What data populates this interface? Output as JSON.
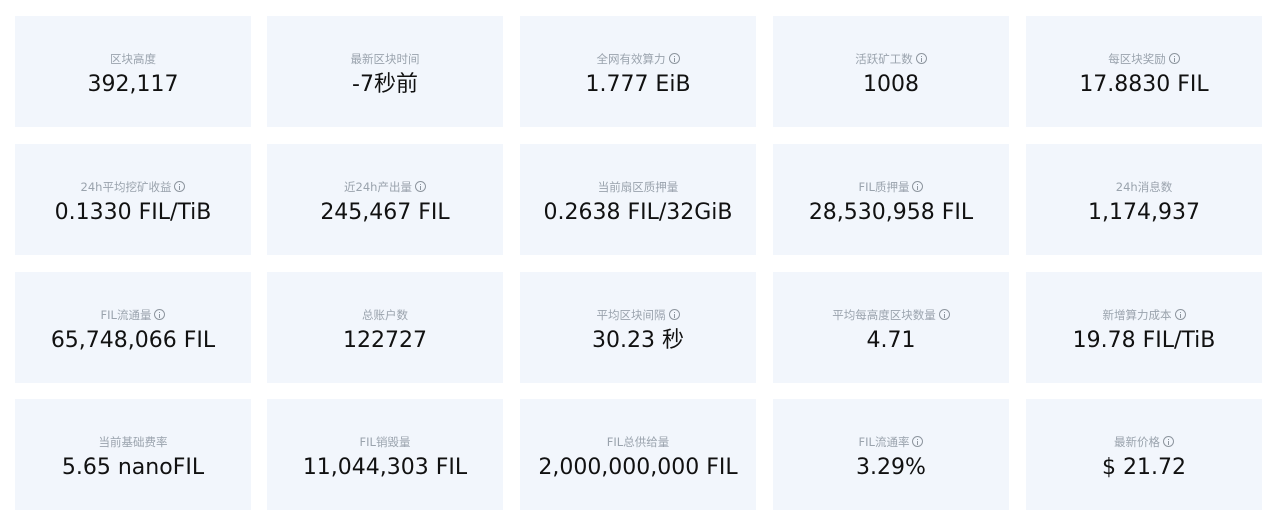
{
  "stats": [
    {
      "label": "区块高度",
      "value": "392,117",
      "info": false
    },
    {
      "label": "最新区块时间",
      "value": "-7秒前",
      "info": false
    },
    {
      "label": "全网有效算力",
      "value": "1.777 EiB",
      "info": true
    },
    {
      "label": "活跃矿工数",
      "value": "1008",
      "info": true
    },
    {
      "label": "每区块奖励",
      "value": "17.8830 FIL",
      "info": true
    },
    {
      "label": "24h平均挖矿收益",
      "value": "0.1330 FIL/TiB",
      "info": true
    },
    {
      "label": "近24h产出量",
      "value": "245,467 FIL",
      "info": true
    },
    {
      "label": "当前扇区质押量",
      "value": "0.2638 FIL/32GiB",
      "info": false
    },
    {
      "label": "FIL质押量",
      "value": "28,530,958 FIL",
      "info": true
    },
    {
      "label": "24h消息数",
      "value": "1,174,937",
      "info": false
    },
    {
      "label": "FIL流通量",
      "value": "65,748,066 FIL",
      "info": true
    },
    {
      "label": "总账户数",
      "value": "122727",
      "info": false
    },
    {
      "label": "平均区块间隔",
      "value": "30.23 秒",
      "info": true
    },
    {
      "label": "平均每高度区块数量",
      "value": "4.71",
      "info": true
    },
    {
      "label": "新增算力成本",
      "value": "19.78 FIL/TiB",
      "info": true
    },
    {
      "label": "当前基础费率",
      "value": "5.65 nanoFIL",
      "info": false
    },
    {
      "label": "FIL销毁量",
      "value": "11,044,303 FIL",
      "info": false
    },
    {
      "label": "FIL总供给量",
      "value": "2,000,000,000 FIL",
      "info": false
    },
    {
      "label": "FIL流通率",
      "value": "3.29%",
      "info": true
    },
    {
      "label": "最新价格",
      "value": "$ 21.72",
      "info": true
    }
  ]
}
